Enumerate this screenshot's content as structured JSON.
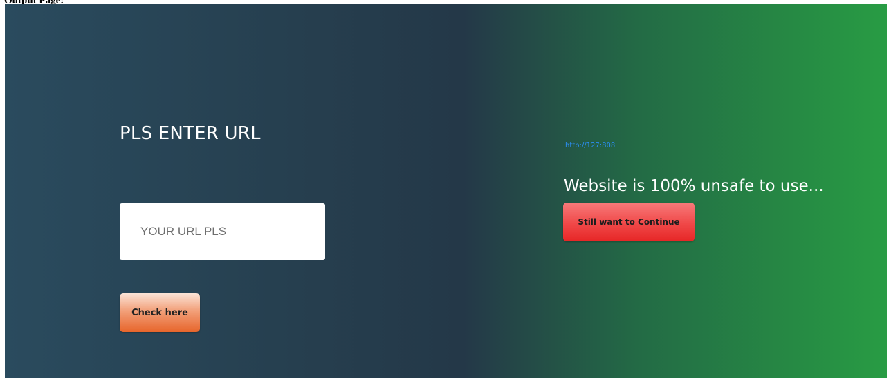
{
  "caption": "Output Page:",
  "form": {
    "heading": "PLS ENTER URL",
    "url_placeholder": "YOUR URL PLS",
    "url_value": "",
    "check_label": "Check here"
  },
  "result": {
    "url": "http://127:808",
    "message": "Website is 100% unsafe to use...",
    "continue_label": "Still want to Continue"
  },
  "colors": {
    "gradient_left": "#2a4b5e",
    "gradient_mid": "#243848",
    "gradient_right": "#289c44",
    "link": "#2b8ef5",
    "check_button": "#e7652b",
    "continue_button": "#f04848"
  }
}
